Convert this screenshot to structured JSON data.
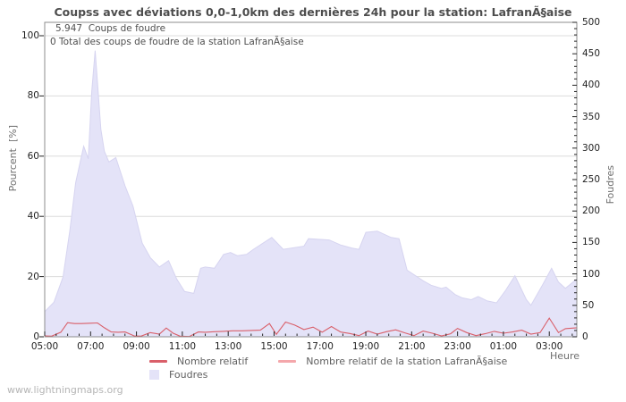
{
  "annotations": {
    "line1": "5.947  Coups de foudre",
    "line2": "0 Total des coups de foudre de la station LafranÃ§aise"
  },
  "watermark": "www.lightningmaps.org",
  "chart_data": {
    "type": "area",
    "title": "Coupss avec déviations 0,0-1,0km des dernières 24h pour la station: LafranÃ§aise",
    "x_axis": {
      "label": "Heure",
      "tick_hours": [
        0,
        2,
        4,
        6,
        8,
        10,
        12,
        14,
        16,
        18,
        20,
        22
      ],
      "tick_labels": [
        "05:00",
        "07:00",
        "09:00",
        "11:00",
        "13:00",
        "15:00",
        "17:00",
        "19:00",
        "21:00",
        "23:00",
        "01:00",
        "03:00"
      ],
      "minor_step_hours": 0.5,
      "span_hours": 23.2
    },
    "y_left": {
      "label": "Pourcent  [%]",
      "range": [
        0,
        100
      ],
      "ticks": [
        0,
        20,
        40,
        60,
        80,
        100
      ]
    },
    "y_right": {
      "label": "Foudres",
      "range": [
        0,
        500
      ],
      "ticks": [
        0,
        50,
        100,
        150,
        200,
        250,
        300,
        350,
        400,
        450,
        500
      ],
      "minor_step": 10
    },
    "grid": "horizontal",
    "legend_position": "bottom",
    "colors": {
      "area": "#e4e3f8",
      "area_edge": "#d6d4f0",
      "line_relative": "#d95f69",
      "line_station": "#f4a7ab",
      "grid": "#dcdcdc",
      "axis": "#8c8c8c",
      "tick": "#222222"
    },
    "series": [
      {
        "name": "Nombre relatif",
        "type": "line",
        "axis": "left",
        "color": "#d95f69",
        "points": [
          [
            0,
            0.3
          ],
          [
            0.3,
            0.2
          ],
          [
            0.7,
            1.5
          ],
          [
            1,
            4.7
          ],
          [
            1.3,
            4.4
          ],
          [
            1.6,
            4.4
          ],
          [
            2,
            4.5
          ],
          [
            2.3,
            4.6
          ],
          [
            2.6,
            3
          ],
          [
            2.9,
            1.6
          ],
          [
            3.2,
            1.5
          ],
          [
            3.5,
            1.6
          ],
          [
            3.9,
            0.3
          ],
          [
            4.2,
            0.2
          ],
          [
            4.6,
            1.4
          ],
          [
            5,
            0.9
          ],
          [
            5.3,
            2.9
          ],
          [
            5.6,
            1.2
          ],
          [
            5.9,
            0.2
          ],
          [
            6.3,
            0.1
          ],
          [
            6.7,
            1.6
          ],
          [
            7,
            1.5
          ],
          [
            7.4,
            1.7
          ],
          [
            7.8,
            1.8
          ],
          [
            8.2,
            2
          ],
          [
            8.6,
            2
          ],
          [
            9,
            2.1
          ],
          [
            9.4,
            2.2
          ],
          [
            9.8,
            4.4
          ],
          [
            10.1,
            0.8
          ],
          [
            10.5,
            4.9
          ],
          [
            10.9,
            3.9
          ],
          [
            11.3,
            2.4
          ],
          [
            11.7,
            3.2
          ],
          [
            12.1,
            1.5
          ],
          [
            12.5,
            3.4
          ],
          [
            12.9,
            1.6
          ],
          [
            13.3,
            1.1
          ],
          [
            13.7,
            0.4
          ],
          [
            14.1,
            1.9
          ],
          [
            14.5,
            0.9
          ],
          [
            14.9,
            1.7
          ],
          [
            15.3,
            2.3
          ],
          [
            15.7,
            1.3
          ],
          [
            16.1,
            0.4
          ],
          [
            16.5,
            1.9
          ],
          [
            16.9,
            1.2
          ],
          [
            17.3,
            0.3
          ],
          [
            17.7,
            1
          ],
          [
            18,
            2.8
          ],
          [
            18.4,
            1.4
          ],
          [
            18.8,
            0.4
          ],
          [
            19.2,
            1
          ],
          [
            19.6,
            1.8
          ],
          [
            20,
            1.2
          ],
          [
            20.4,
            1.6
          ],
          [
            20.8,
            2.2
          ],
          [
            21.2,
            0.9
          ],
          [
            21.6,
            1.4
          ],
          [
            22,
            6.2
          ],
          [
            22.4,
            1.4
          ],
          [
            22.7,
            2.7
          ],
          [
            23.2,
            3
          ]
        ]
      },
      {
        "name": "Nombre relatif de la station LafranÃ§aise",
        "type": "line",
        "axis": "left",
        "color": "#f4a7ab",
        "points": [
          [
            0,
            0
          ],
          [
            23.2,
            0
          ]
        ]
      },
      {
        "name": "Foudres",
        "type": "area",
        "axis": "right",
        "color": "#e4e3f8",
        "edge": "#d6d4f0",
        "points": [
          [
            0,
            40
          ],
          [
            0.4,
            55
          ],
          [
            0.8,
            95
          ],
          [
            1.1,
            170
          ],
          [
            1.35,
            245
          ],
          [
            1.7,
            303
          ],
          [
            1.9,
            283
          ],
          [
            2.05,
            390
          ],
          [
            2.2,
            455
          ],
          [
            2.45,
            330
          ],
          [
            2.6,
            295
          ],
          [
            2.8,
            278
          ],
          [
            3.1,
            285
          ],
          [
            3.5,
            240
          ],
          [
            3.85,
            208
          ],
          [
            4.25,
            149
          ],
          [
            4.6,
            126
          ],
          [
            5,
            111
          ],
          [
            5.4,
            121
          ],
          [
            5.75,
            92
          ],
          [
            6.1,
            72
          ],
          [
            6.5,
            69
          ],
          [
            6.8,
            109
          ],
          [
            7,
            111
          ],
          [
            7.4,
            109
          ],
          [
            7.8,
            131
          ],
          [
            8.1,
            134
          ],
          [
            8.4,
            129
          ],
          [
            8.8,
            131
          ],
          [
            9.1,
            139
          ],
          [
            9.9,
            158
          ],
          [
            10.4,
            139
          ],
          [
            11.3,
            144
          ],
          [
            11.5,
            156
          ],
          [
            12.4,
            154
          ],
          [
            12.9,
            146
          ],
          [
            13.4,
            141
          ],
          [
            13.7,
            139
          ],
          [
            14,
            166
          ],
          [
            14.5,
            168
          ],
          [
            15.1,
            158
          ],
          [
            15.45,
            156
          ],
          [
            15.8,
            106
          ],
          [
            16.5,
            89
          ],
          [
            16.85,
            82
          ],
          [
            17.3,
            77
          ],
          [
            17.5,
            79
          ],
          [
            17.9,
            67
          ],
          [
            18.2,
            62
          ],
          [
            18.6,
            59
          ],
          [
            18.9,
            64
          ],
          [
            19.3,
            57
          ],
          [
            19.7,
            54
          ],
          [
            20.1,
            74
          ],
          [
            20.5,
            97
          ],
          [
            21,
            59
          ],
          [
            21.2,
            50
          ],
          [
            21.7,
            82
          ],
          [
            22.1,
            109
          ],
          [
            22.4,
            87
          ],
          [
            22.7,
            77
          ],
          [
            23.2,
            92
          ]
        ]
      }
    ]
  }
}
